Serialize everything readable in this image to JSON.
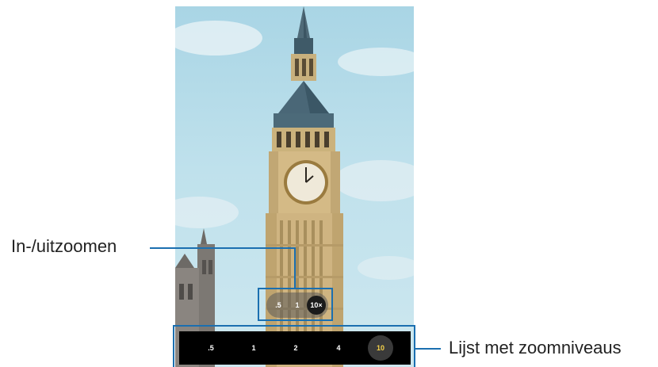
{
  "callouts": {
    "zoom_in_out": "In-/uitzoomen",
    "zoom_levels_list": "Lijst met zoomniveaus"
  },
  "quick_zoom": {
    "buttons": [
      ".5",
      "1",
      "10×"
    ],
    "selected": "10×"
  },
  "zoom_levels": {
    "buttons": [
      ".5",
      "1",
      "2",
      "4",
      "10"
    ],
    "selected": "10"
  },
  "colors": {
    "callout_line": "#1b6fb0",
    "selected_zoom_text": "#f5d24a"
  }
}
